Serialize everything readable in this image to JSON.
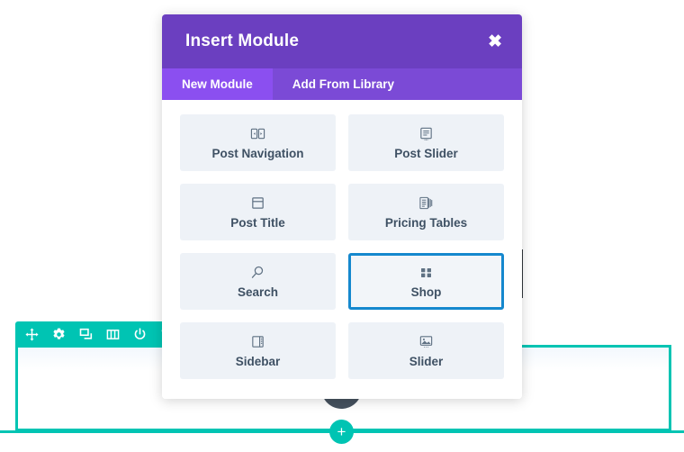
{
  "modal": {
    "title": "Insert Module",
    "close_label": "✖",
    "tabs": [
      {
        "label": "New Module",
        "active": true
      },
      {
        "label": "Add From Library",
        "active": false
      }
    ],
    "modules": [
      {
        "label": "Post Navigation",
        "icon": "post-navigation-icon",
        "selected": false
      },
      {
        "label": "Post Slider",
        "icon": "post-slider-icon",
        "selected": false
      },
      {
        "label": "Post Title",
        "icon": "post-title-icon",
        "selected": false
      },
      {
        "label": "Pricing Tables",
        "icon": "pricing-tables-icon",
        "selected": false
      },
      {
        "label": "Search",
        "icon": "search-icon",
        "selected": false
      },
      {
        "label": "Shop",
        "icon": "shop-icon",
        "selected": true
      },
      {
        "label": "Sidebar",
        "icon": "sidebar-icon",
        "selected": false
      },
      {
        "label": "Slider",
        "icon": "slider-icon",
        "selected": false
      }
    ]
  },
  "builder": {
    "row_toolbar": [
      {
        "icon": "move-icon"
      },
      {
        "icon": "gear-icon"
      },
      {
        "icon": "duplicate-icon"
      },
      {
        "icon": "columns-icon"
      },
      {
        "icon": "power-icon"
      },
      {
        "icon": "trash-icon"
      }
    ],
    "add_module_label": "+",
    "add_row_label": "+"
  },
  "colors": {
    "modal_header": "#6b3fc0",
    "tab_bar": "#7b4ad6",
    "tab_active": "#8b4ff0",
    "tile_bg": "#eef2f7",
    "tile_text": "#3f5164",
    "selected_outline": "#1588ce",
    "builder_teal": "#00c4b3",
    "dark_button": "#46525f",
    "handle_dark": "#31363c"
  }
}
